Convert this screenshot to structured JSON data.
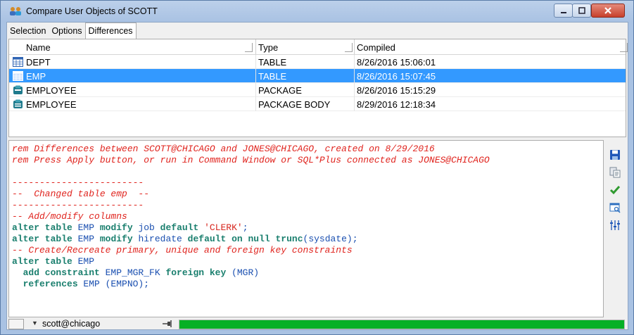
{
  "window": {
    "title": "Compare User Objects of SCOTT"
  },
  "tabs": [
    {
      "label": "Selection"
    },
    {
      "label": "Options"
    },
    {
      "label": "Differences",
      "active": true
    }
  ],
  "grid": {
    "columns": [
      "Name",
      "Type",
      "Compiled"
    ],
    "rows": [
      {
        "icon": "table-icon",
        "name": "DEPT",
        "type": "TABLE",
        "compiled": "8/26/2016 15:06:01",
        "selected": false
      },
      {
        "icon": "table-icon",
        "name": "EMP",
        "type": "TABLE",
        "compiled": "8/26/2016 15:07:45",
        "selected": true
      },
      {
        "icon": "package-icon",
        "name": "EMPLOYEE",
        "type": "PACKAGE",
        "compiled": "8/26/2016 15:15:29",
        "selected": false
      },
      {
        "icon": "package-body-icon",
        "name": "EMPLOYEE",
        "type": "PACKAGE BODY",
        "compiled": "8/29/2016 12:18:34",
        "selected": false
      }
    ]
  },
  "editor": {
    "lines": [
      [
        {
          "t": "rem Differences between SCOTT@CHICAGO and JONES@CHICAGO, created on 8/29/2016",
          "c": "rem"
        }
      ],
      [
        {
          "t": "rem Press Apply button, or run in Command Window or SQL*Plus connected as JONES@CHICAGO",
          "c": "rem"
        }
      ],
      [
        {
          "t": "",
          "c": "txt"
        }
      ],
      [
        {
          "t": "------------------------",
          "c": "rem"
        }
      ],
      [
        {
          "t": "--  Changed table emp  --",
          "c": "rem"
        }
      ],
      [
        {
          "t": "------------------------",
          "c": "rem"
        }
      ],
      [
        {
          "t": "-- Add/modify columns",
          "c": "rem"
        }
      ],
      [
        {
          "t": "alter table ",
          "c": "kw"
        },
        {
          "t": "EMP ",
          "c": "id"
        },
        {
          "t": "modify ",
          "c": "kw"
        },
        {
          "t": "job ",
          "c": "id"
        },
        {
          "t": "default ",
          "c": "kw"
        },
        {
          "t": "'CLERK'",
          "c": "str"
        },
        {
          "t": ";",
          "c": "txt"
        }
      ],
      [
        {
          "t": "alter table ",
          "c": "kw"
        },
        {
          "t": "EMP ",
          "c": "id"
        },
        {
          "t": "modify ",
          "c": "kw"
        },
        {
          "t": "hiredate ",
          "c": "id"
        },
        {
          "t": "default on null ",
          "c": "kw"
        },
        {
          "t": "trunc",
          "c": "kw"
        },
        {
          "t": "(sysdate);",
          "c": "id"
        }
      ],
      [
        {
          "t": "-- Create/Recreate primary, unique and foreign key constraints",
          "c": "rem"
        }
      ],
      [
        {
          "t": "alter table ",
          "c": "kw"
        },
        {
          "t": "EMP",
          "c": "id"
        }
      ],
      [
        {
          "t": "  add constraint ",
          "c": "kw"
        },
        {
          "t": "EMP_MGR_FK ",
          "c": "id"
        },
        {
          "t": "foreign key ",
          "c": "kw"
        },
        {
          "t": "(MGR)",
          "c": "id"
        }
      ],
      [
        {
          "t": "  references ",
          "c": "kw"
        },
        {
          "t": "EMP (EMPNO);",
          "c": "id"
        }
      ]
    ]
  },
  "tools": [
    {
      "name": "save-icon",
      "color": "#1f57b8"
    },
    {
      "name": "copy-icon",
      "color": "#7a8896"
    },
    {
      "name": "apply-check-icon",
      "color": "#2f9a2f"
    },
    {
      "name": "preview-icon",
      "color": "#2c6fbf"
    },
    {
      "name": "settings-sliders-icon",
      "color": "#1f57b8"
    }
  ],
  "status": {
    "connection": "scott@chicago",
    "progress": 1.0,
    "progress_color": "#06b025"
  },
  "colors": {
    "selection": "#3399ff",
    "comment": "#e0241e",
    "keyword": "#1a7f6e",
    "identifier": "#1a4fb0"
  }
}
